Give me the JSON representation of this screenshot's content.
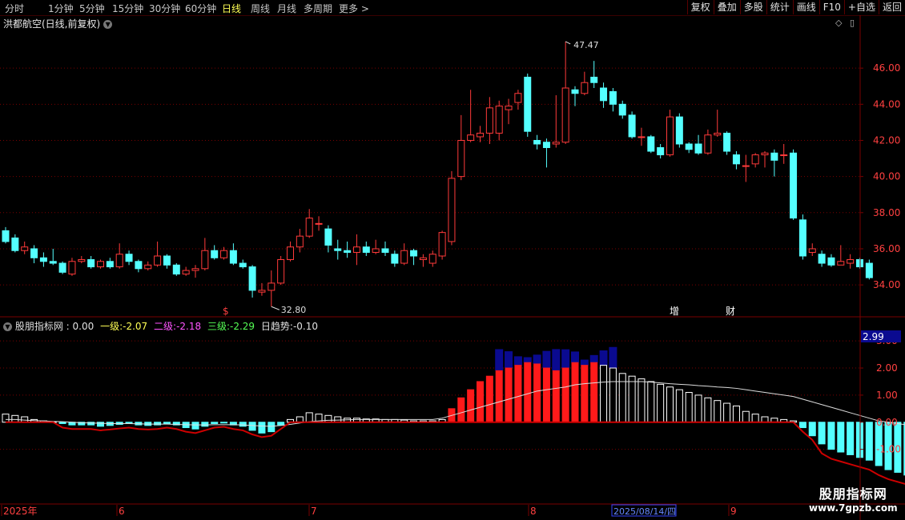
{
  "toolbar": {
    "periods": [
      "分时",
      "1分钟",
      "5分钟",
      "15分钟",
      "30分钟",
      "60分钟",
      "日线",
      "周线",
      "月线",
      "多周期",
      "更多"
    ],
    "active_period": "日线",
    "right_buttons": [
      "复权",
      "叠加",
      "多股",
      "统计",
      "画线",
      "F10",
      "+自选",
      "返回"
    ],
    "more_arrow": ">"
  },
  "chart_header": {
    "title": "洪都航空(日线,前复权)"
  },
  "indicator_header": {
    "name": "股朋指标网",
    "value0": ": 0.00",
    "l1_label": "一级:",
    "l1_value": "-2.07",
    "l2_label": "二级:",
    "l2_value": "-2.18",
    "l3_label": "三级:",
    "l3_value": "-2.29",
    "trend_label": "日趋势:",
    "trend_value": "-0.10",
    "current_value_badge": "2.99"
  },
  "annotations": {
    "high_label": "47.47",
    "low_label": "32.80",
    "event_zeng": "增",
    "event_cai": "财",
    "event_mark": "$"
  },
  "x_axis": {
    "labels": [
      "2025年",
      "6",
      "7",
      "8",
      "9"
    ],
    "cursor_date": "2025/08/14/四"
  },
  "watermark": {
    "line1": "股朋指标网",
    "line2": "www.7gpzb.com"
  },
  "colors": {
    "up": "#ff3a3a",
    "down": "#54ffff",
    "grid": "#7a0000",
    "axis_text": "#ff4040",
    "navy": "#0a0a90",
    "crimson": "#cc0000"
  },
  "chart_data": {
    "type": "candlestick",
    "price_axis": {
      "ticks": [
        34.0,
        36.0,
        38.0,
        40.0,
        42.0,
        44.0,
        46.0
      ],
      "range": [
        32.5,
        48.0
      ]
    },
    "indicator_axis": {
      "ticks": [
        -1.0,
        0.0,
        1.0,
        2.0,
        3.0
      ],
      "range": [
        -2.9,
        3.3
      ]
    },
    "candles": [
      [
        37.0,
        36.4,
        37.2,
        36.3
      ],
      [
        36.6,
        35.9,
        36.8,
        35.8
      ],
      [
        35.9,
        36.1,
        36.4,
        35.7
      ],
      [
        36.0,
        35.5,
        36.2,
        35.2
      ],
      [
        35.5,
        35.3,
        35.8,
        35.0
      ],
      [
        35.3,
        35.2,
        36.0,
        35.1
      ],
      [
        35.2,
        34.7,
        35.3,
        34.6
      ],
      [
        34.6,
        35.3,
        35.5,
        34.5
      ],
      [
        35.3,
        35.4,
        35.6,
        35.2
      ],
      [
        35.4,
        35.0,
        35.6,
        34.9
      ],
      [
        35.0,
        35.3,
        35.4,
        34.9
      ],
      [
        35.3,
        35.0,
        35.5,
        34.9
      ],
      [
        35.0,
        35.7,
        36.3,
        34.9
      ],
      [
        35.7,
        35.3,
        35.9,
        35.1
      ],
      [
        35.3,
        34.9,
        35.4,
        34.7
      ],
      [
        34.9,
        35.1,
        35.3,
        34.8
      ],
      [
        35.1,
        35.6,
        36.4,
        35.0
      ],
      [
        35.6,
        35.1,
        35.7,
        34.9
      ],
      [
        35.1,
        34.6,
        35.2,
        34.5
      ],
      [
        34.6,
        34.8,
        35.0,
        34.5
      ],
      [
        34.8,
        34.9,
        35.1,
        34.4
      ],
      [
        34.9,
        35.9,
        36.6,
        34.8
      ],
      [
        35.9,
        35.5,
        36.2,
        35.4
      ],
      [
        35.5,
        35.9,
        36.1,
        35.4
      ],
      [
        35.9,
        35.2,
        36.3,
        35.1
      ],
      [
        35.2,
        35.0,
        35.4,
        34.9
      ],
      [
        35.0,
        33.7,
        35.1,
        33.3
      ],
      [
        33.6,
        33.7,
        34.1,
        33.4
      ],
      [
        33.7,
        34.1,
        34.8,
        32.8
      ],
      [
        34.1,
        35.4,
        35.6,
        34.0
      ],
      [
        35.4,
        36.1,
        36.4,
        35.3
      ],
      [
        36.1,
        36.7,
        37.1,
        35.8
      ],
      [
        36.7,
        37.7,
        38.2,
        36.6
      ],
      [
        37.4,
        37.4,
        37.8,
        37.0
      ],
      [
        37.1,
        36.2,
        37.3,
        35.8
      ],
      [
        36.0,
        35.9,
        36.5,
        35.4
      ],
      [
        35.9,
        35.8,
        36.4,
        35.5
      ],
      [
        35.8,
        36.1,
        36.8,
        35.1
      ],
      [
        36.1,
        35.8,
        36.4,
        35.6
      ],
      [
        35.8,
        36.0,
        36.5,
        35.7
      ],
      [
        36.0,
        35.8,
        36.4,
        35.6
      ],
      [
        35.7,
        35.2,
        35.9,
        35.0
      ],
      [
        35.2,
        35.9,
        36.3,
        35.1
      ],
      [
        35.9,
        35.6,
        36.0,
        35.1
      ],
      [
        35.4,
        35.5,
        35.7,
        35.0
      ],
      [
        35.2,
        35.7,
        35.9,
        35.0
      ],
      [
        35.6,
        36.9,
        37.0,
        35.4
      ],
      [
        36.4,
        39.9,
        40.3,
        36.2
      ],
      [
        40.0,
        42.0,
        43.4,
        39.8
      ],
      [
        42.0,
        42.3,
        44.8,
        41.9
      ],
      [
        42.2,
        42.4,
        42.8,
        41.9
      ],
      [
        42.4,
        43.8,
        44.4,
        41.8
      ],
      [
        42.4,
        43.9,
        44.2,
        42.0
      ],
      [
        43.7,
        43.9,
        44.3,
        42.9
      ],
      [
        44.1,
        44.6,
        44.8,
        43.7
      ],
      [
        45.5,
        42.5,
        45.7,
        42.2
      ],
      [
        42.0,
        41.8,
        42.3,
        41.5
      ],
      [
        41.9,
        41.6,
        42.1,
        40.5
      ],
      [
        41.8,
        41.9,
        44.5,
        41.6
      ],
      [
        41.9,
        44.9,
        47.47,
        41.8
      ],
      [
        44.8,
        44.6,
        45.0,
        43.9
      ],
      [
        44.6,
        45.2,
        45.8,
        44.5
      ],
      [
        45.5,
        45.2,
        46.4,
        44.9
      ],
      [
        44.9,
        44.2,
        45.2,
        43.8
      ],
      [
        44.7,
        44.0,
        44.9,
        43.6
      ],
      [
        44.0,
        43.4,
        44.2,
        43.2
      ],
      [
        43.4,
        42.2,
        43.6,
        42.1
      ],
      [
        42.2,
        42.2,
        42.7,
        41.7
      ],
      [
        42.2,
        41.4,
        42.3,
        41.3
      ],
      [
        41.6,
        41.2,
        41.8,
        41.0
      ],
      [
        41.2,
        43.3,
        43.7,
        41.1
      ],
      [
        43.3,
        41.8,
        43.5,
        41.6
      ],
      [
        41.8,
        41.5,
        41.9,
        41.3
      ],
      [
        41.8,
        41.3,
        42.3,
        41.2
      ],
      [
        41.3,
        42.3,
        42.6,
        41.2
      ],
      [
        42.3,
        42.4,
        43.7,
        42.2
      ],
      [
        42.4,
        41.4,
        42.5,
        41.2
      ],
      [
        41.2,
        40.7,
        41.4,
        40.4
      ],
      [
        40.6,
        40.6,
        41.2,
        39.7
      ],
      [
        40.7,
        41.2,
        41.3,
        40.5
      ],
      [
        41.2,
        41.3,
        41.4,
        40.5
      ],
      [
        41.3,
        40.9,
        41.5,
        40.0
      ],
      [
        41.2,
        41.2,
        41.8,
        40.7
      ],
      [
        41.3,
        37.7,
        41.5,
        37.6
      ],
      [
        37.6,
        35.6,
        37.9,
        35.4
      ],
      [
        35.8,
        36.0,
        36.3,
        35.6
      ],
      [
        35.7,
        35.2,
        35.9,
        35.0
      ],
      [
        35.5,
        35.1,
        35.7,
        35.0
      ],
      [
        35.1,
        35.3,
        36.2,
        35.1
      ],
      [
        35.2,
        35.4,
        35.7,
        34.9
      ],
      [
        35.4,
        35.0,
        35.5,
        34.9
      ],
      [
        35.2,
        34.4,
        35.4,
        34.3
      ]
    ],
    "indicator": {
      "histogram": [
        0.3,
        0.25,
        0.2,
        0.1,
        0.05,
        0.02,
        -0.05,
        -0.1,
        -0.1,
        -0.1,
        -0.15,
        -0.12,
        -0.08,
        -0.05,
        -0.1,
        -0.12,
        -0.1,
        -0.05,
        -0.1,
        -0.2,
        -0.25,
        -0.15,
        -0.05,
        -0.02,
        -0.1,
        -0.15,
        -0.3,
        -0.4,
        -0.35,
        -0.1,
        0.1,
        0.2,
        0.35,
        0.3,
        0.25,
        0.2,
        0.15,
        0.15,
        0.12,
        0.12,
        0.1,
        0.1,
        0.08,
        0.05,
        0.05,
        0.05,
        0.1,
        0.5,
        0.9,
        1.2,
        1.5,
        1.7,
        1.9,
        2.0,
        2.1,
        2.2,
        2.15,
        2.0,
        1.9,
        2.0,
        2.2,
        2.1,
        2.2,
        2.1,
        2.0,
        1.8,
        1.7,
        1.6,
        1.5,
        1.4,
        1.3,
        1.2,
        1.1,
        1.0,
        0.9,
        0.8,
        0.7,
        0.6,
        0.4,
        0.3,
        0.2,
        0.15,
        0.1,
        0.05,
        -0.2,
        -0.5,
        -0.8,
        -1.0,
        -1.1,
        -1.2,
        -1.3,
        -1.4,
        -1.6,
        -1.75,
        -1.85,
        -1.95
      ],
      "trend_line": [
        0.1,
        0.1,
        0.08,
        0.06,
        0.05,
        0.03,
        0.02,
        0.0,
        -0.02,
        -0.03,
        -0.04,
        -0.05,
        -0.05,
        -0.05,
        -0.06,
        -0.07,
        -0.07,
        -0.07,
        -0.08,
        -0.09,
        -0.1,
        -0.1,
        -0.09,
        -0.09,
        -0.09,
        -0.1,
        -0.12,
        -0.14,
        -0.15,
        -0.12,
        -0.08,
        -0.03,
        0.02,
        0.05,
        0.07,
        0.08,
        0.09,
        0.1,
        0.1,
        0.1,
        0.1,
        0.1,
        0.1,
        0.1,
        0.1,
        0.1,
        0.15,
        0.25,
        0.35,
        0.45,
        0.55,
        0.65,
        0.75,
        0.85,
        0.95,
        1.05,
        1.15,
        1.2,
        1.25,
        1.3,
        1.38,
        1.42,
        1.45,
        1.48,
        1.5,
        1.5,
        1.5,
        1.5,
        1.48,
        1.45,
        1.42,
        1.4,
        1.38,
        1.35,
        1.33,
        1.3,
        1.28,
        1.25,
        1.2,
        1.15,
        1.1,
        1.05,
        1.0,
        0.95,
        0.85,
        0.75,
        0.65,
        0.55,
        0.45,
        0.35,
        0.25,
        0.15,
        0.05,
        0.0,
        -0.05,
        -0.1
      ]
    }
  }
}
